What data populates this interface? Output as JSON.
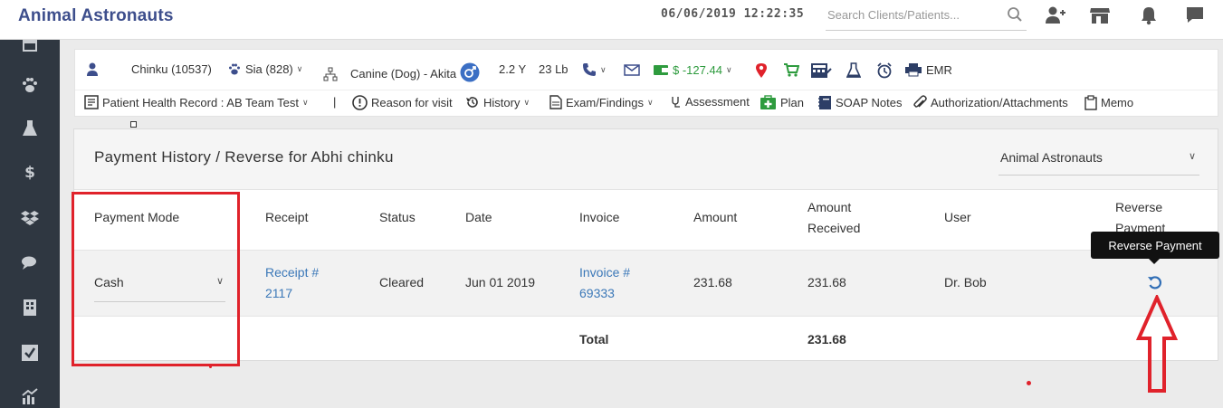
{
  "app": {
    "title": "Animal Astronauts",
    "datetime": "06/06/2019 12:22:35"
  },
  "search": {
    "placeholder": "Search Clients/Patients..."
  },
  "top_icons": [
    "search-icon",
    "add-user-icon",
    "store-icon",
    "bell-icon",
    "chat-icon"
  ],
  "sidebar": {
    "items": [
      "calendar-icon",
      "paw-icon",
      "flask-icon",
      "dollar-icon",
      "dropbox-icon",
      "comments-icon",
      "building-icon",
      "checkbox-icon",
      "chart-icon"
    ]
  },
  "patient": {
    "client": "Chinku (10537)",
    "pet": "Sia (828)",
    "species": "Canine (Dog) - Akita",
    "age": "2.2 Y",
    "weight": "23 Lb",
    "balance": "$ -127.44",
    "emr": "EMR"
  },
  "record_nav": {
    "phr": "Patient Health Record : AB Team Test",
    "separator": "|",
    "reason": "Reason for visit",
    "history": "History",
    "exam": "Exam/Findings",
    "assessment": "Assessment",
    "plan": "Plan",
    "soap": "SOAP Notes",
    "attachments": "Authorization/Attachments",
    "memo": "Memo"
  },
  "panel": {
    "title": "Payment History / Reverse for Abhi chinku",
    "clinic": "Animal Astronauts"
  },
  "table": {
    "headers": {
      "payment_mode": "Payment Mode",
      "receipt": "Receipt",
      "status": "Status",
      "date": "Date",
      "invoice": "Invoice",
      "amount": "Amount",
      "amount_received_1": "Amount",
      "amount_received_2": "Received",
      "user": "User",
      "reverse_1": "Reverse",
      "reverse_2": "Payment"
    },
    "row": {
      "payment_mode": "Cash",
      "receipt_1": "Receipt #",
      "receipt_2": "2117",
      "status": "Cleared",
      "date": "Jun 01 2019",
      "invoice_1": "Invoice #",
      "invoice_2": "69333",
      "amount": "231.68",
      "amount_received": "231.68",
      "user": "Dr. Bob"
    },
    "total_label": "Total",
    "total_value": "231.68"
  },
  "tooltip": {
    "text": "Reverse Payment"
  },
  "colors": {
    "brand": "#3d4e8c",
    "link": "#3b78b8",
    "sidebar": "#2f3741",
    "annotation": "#e0222b",
    "green": "#2e9b3e"
  }
}
